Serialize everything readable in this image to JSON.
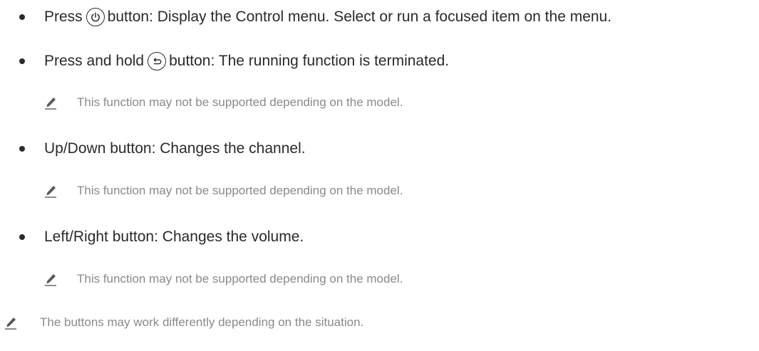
{
  "items": [
    {
      "before": "Press",
      "icon": "power-icon",
      "after": "button: Display the Control menu. Select or run a focused item on the menu."
    },
    {
      "before": "Press and hold",
      "icon": "return-icon",
      "after": "button: The running function is terminated."
    },
    {
      "text": "Up/Down button: Changes the channel."
    },
    {
      "text": "Left/Right button: Changes the volume."
    }
  ],
  "notes": {
    "model_support": "This function may not be supported depending on the model.",
    "final": "The buttons may work differently depending on the situation."
  },
  "colors": {
    "text": "#2a2a2a",
    "note": "#8a8a8a"
  },
  "icons": {
    "note": "pencil-note-icon"
  }
}
